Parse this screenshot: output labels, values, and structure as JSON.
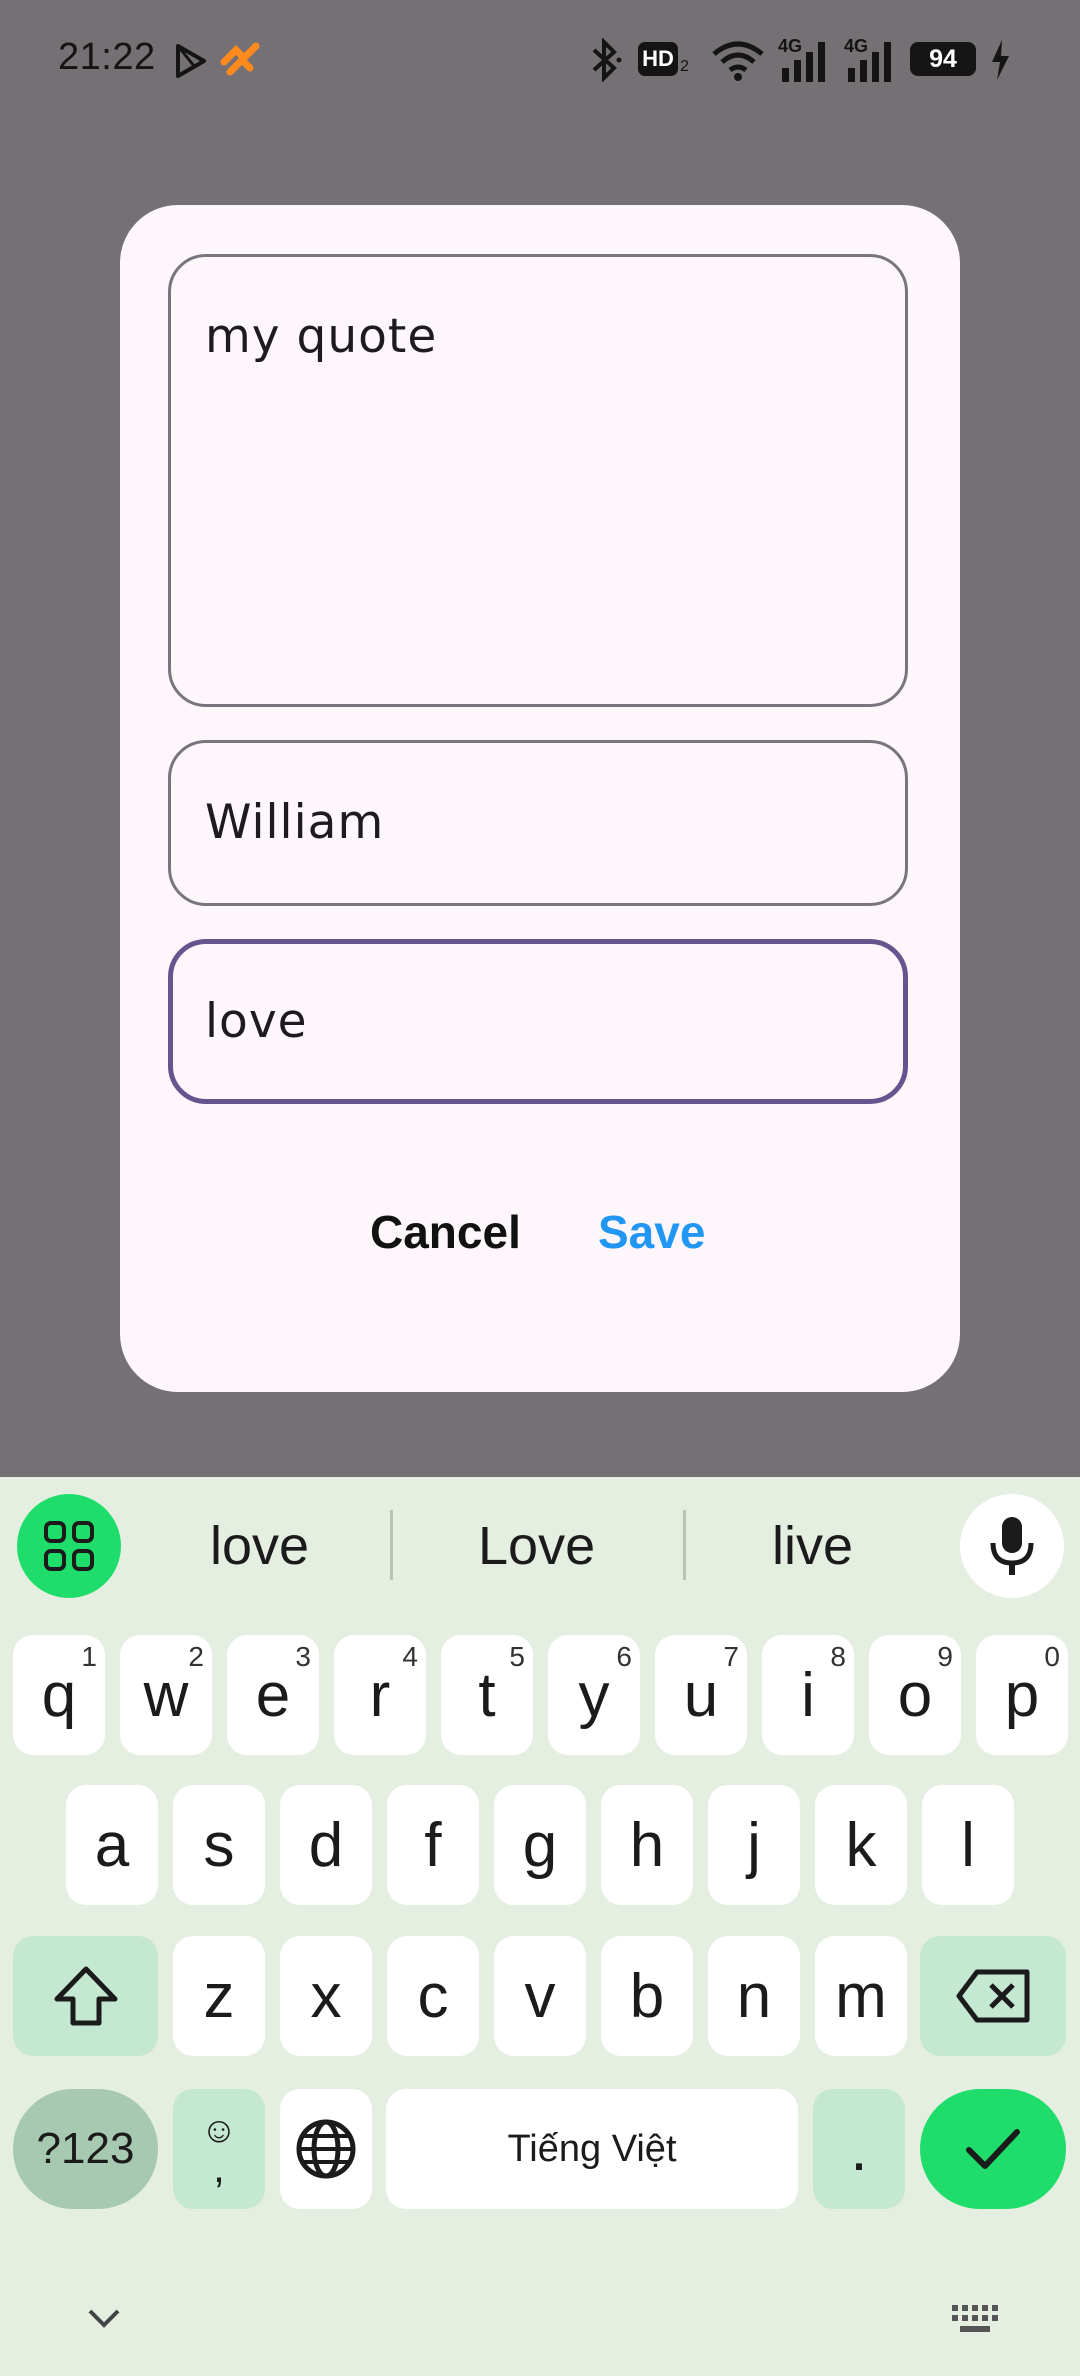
{
  "status": {
    "time": "21:22",
    "battery": "94",
    "hd_label": "HD",
    "network_1": "4G",
    "network_2": "4G"
  },
  "dialog": {
    "quote_value": "my quote",
    "author_value": "William",
    "tag_value": "love",
    "cancel_label": "Cancel",
    "save_label": "Save"
  },
  "keyboard": {
    "suggestions": [
      "love",
      "Love",
      "live"
    ],
    "row1": [
      {
        "k": "q",
        "h": "1"
      },
      {
        "k": "w",
        "h": "2"
      },
      {
        "k": "e",
        "h": "3"
      },
      {
        "k": "r",
        "h": "4"
      },
      {
        "k": "t",
        "h": "5"
      },
      {
        "k": "y",
        "h": "6"
      },
      {
        "k": "u",
        "h": "7"
      },
      {
        "k": "i",
        "h": "8"
      },
      {
        "k": "o",
        "h": "9"
      },
      {
        "k": "p",
        "h": "0"
      }
    ],
    "row2": [
      "a",
      "s",
      "d",
      "f",
      "g",
      "h",
      "j",
      "k",
      "l"
    ],
    "row3": [
      "z",
      "x",
      "c",
      "v",
      "b",
      "n",
      "m"
    ],
    "symbols_label": "?123",
    "emoji_label": "☺",
    "comma_label": ",",
    "space_label": "Tiếng Việt",
    "period_label": "."
  },
  "colors": {
    "accent": "#67548e",
    "save": "#2196f3",
    "enter": "#1fdd6b"
  }
}
